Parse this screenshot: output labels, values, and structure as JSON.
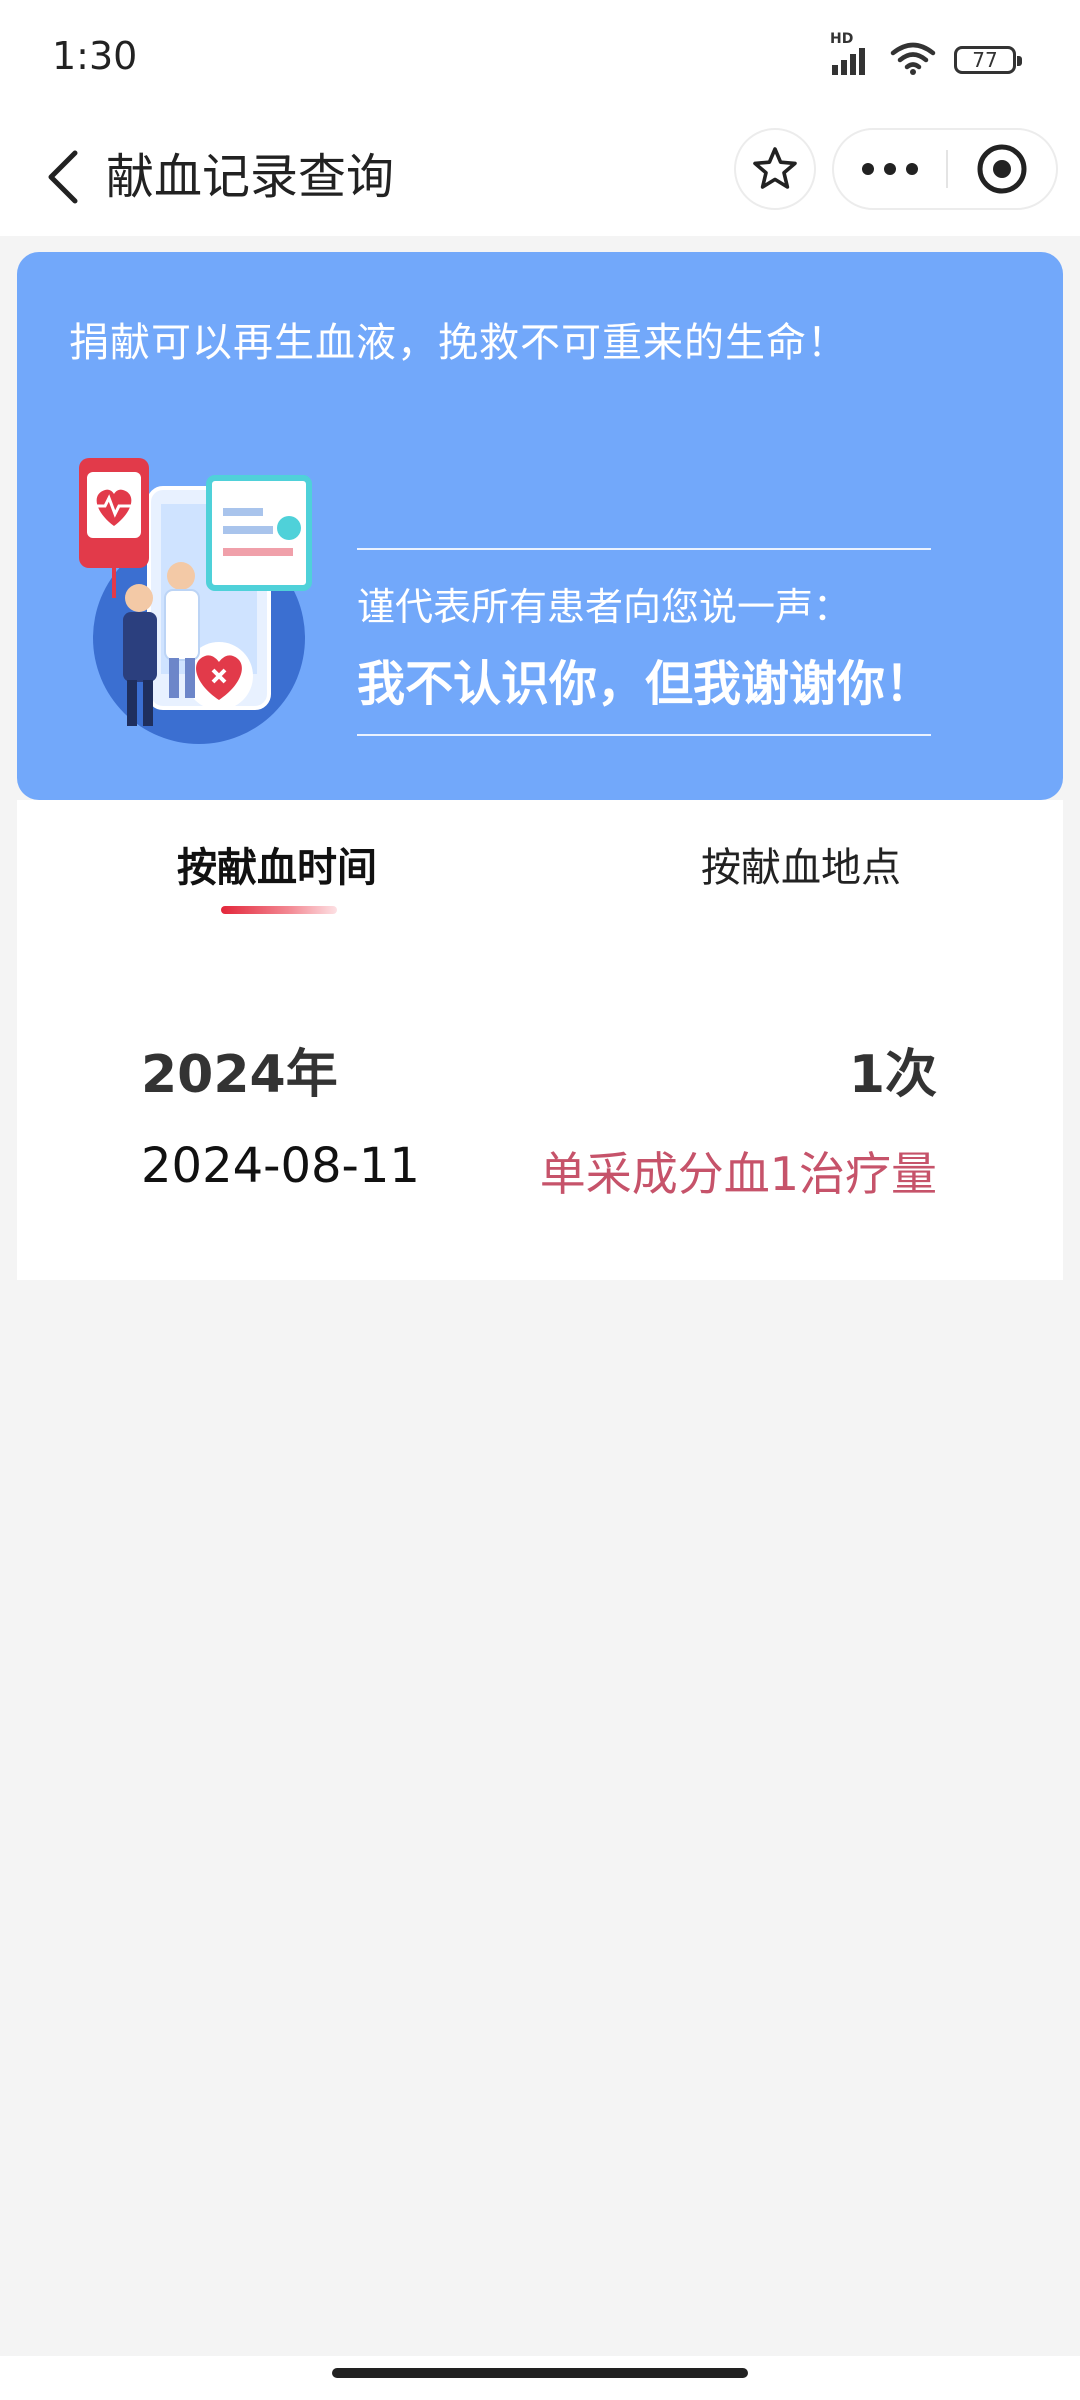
{
  "status_bar": {
    "time": "1:30",
    "network_label": "HD",
    "signal_icon": "signal-bars-icon",
    "wifi_icon": "wifi-icon",
    "battery_level": "77"
  },
  "nav": {
    "title": "献血记录查询",
    "back_icon": "chevron-left-icon",
    "favorite_icon": "star-outline-icon",
    "more_icon": "more-dots-icon",
    "close_icon": "target-circle-icon"
  },
  "banner": {
    "slogan": "捐献可以再生血液，挽救不可重来的生命！",
    "subtitle": "谨代表所有患者向您说一声：",
    "thanks": "我不认识你，但我谢谢你！",
    "background_color": "#72a8fa"
  },
  "tabs": [
    {
      "label": "按献血时间",
      "active": true
    },
    {
      "label": "按献血地点",
      "active": false
    }
  ],
  "records": {
    "year": "2024年",
    "count": "1次",
    "items": [
      {
        "date": "2024-08-11",
        "type": "单采成分血1治疗量"
      }
    ]
  },
  "colors": {
    "accent_red": "#e3263a",
    "record_type": "#c6536a",
    "page_bg": "#f4f4f4"
  }
}
